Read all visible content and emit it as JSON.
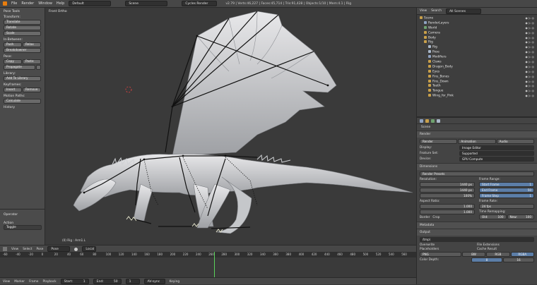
{
  "topbar": {
    "menus": [
      "File",
      "Render",
      "Window",
      "Help"
    ],
    "layout": "Default",
    "scene": "Scene",
    "engine": "Cycles Render",
    "info": "v2.79 | Verts:46,227 | Faces:45,714 | Tris:91,428 | Objects:1/10 | Mem:4.1 | Rig"
  },
  "tools": {
    "pose_tools": "Pose Tools",
    "transform": "Transform:",
    "translate": "Translate",
    "rotate": "Rotate",
    "scale": "Scale",
    "in_between": "In-Between:",
    "push": "Push",
    "relax": "Relax",
    "breakdowner": "Breakdowner",
    "pose": "Pose:",
    "copy": "Copy",
    "paste": "Paste",
    "propagate": "Propagate",
    "library": "Library:",
    "add_to_library": "Add To Library",
    "keyframes": "Keyframes:",
    "insert": "Insert",
    "remove": "Remove",
    "motion_paths": "Motion Paths:",
    "calculate": "Calculate",
    "history": "History",
    "op_title": "Operator",
    "action": "Action",
    "toggle": "Toggle"
  },
  "viewport": {
    "view_label": "Front Ortho",
    "object_label": "(0) Rig : Arm1.L"
  },
  "outliner": {
    "view": "View",
    "search": "Search",
    "filter": "All Scenes",
    "items": [
      {
        "label": "Scene",
        "indent": 0,
        "color": "#c9a04a"
      },
      {
        "label": "RenderLayers",
        "indent": 1,
        "color": "#8fa3c2"
      },
      {
        "label": "World",
        "indent": 1,
        "color": "#6fa26f"
      },
      {
        "label": "Camera",
        "indent": 1,
        "color": "#c9a04a"
      },
      {
        "label": "Body",
        "indent": 1,
        "color": "#c9a04a"
      },
      {
        "label": "Rig",
        "indent": 1,
        "color": "#c9a04a"
      },
      {
        "label": "Rig",
        "indent": 2,
        "color": "#a9b7c9"
      },
      {
        "label": "Pose",
        "indent": 2,
        "color": "#a9b7c9"
      },
      {
        "label": "Modifiers",
        "indent": 2,
        "color": "#8fa3c2"
      },
      {
        "label": "Claws",
        "indent": 2,
        "color": "#c9a04a"
      },
      {
        "label": "Dragon_Body",
        "indent": 2,
        "color": "#c9a04a"
      },
      {
        "label": "Eyes",
        "indent": 2,
        "color": "#c9a04a"
      },
      {
        "label": "Fins_Bones",
        "indent": 2,
        "color": "#c9a04a"
      },
      {
        "label": "Fins_Down",
        "indent": 2,
        "color": "#c9a04a"
      },
      {
        "label": "Teeth",
        "indent": 2,
        "color": "#c9a04a"
      },
      {
        "label": "Tongue",
        "indent": 2,
        "color": "#c9a04a"
      },
      {
        "label": "Wing_for_Pink",
        "indent": 2,
        "color": "#c9a04a"
      }
    ]
  },
  "properties": {
    "scene": "Scene",
    "render_panel": "Render",
    "render_btn": "Render",
    "animation_btn": "Animation",
    "audio_btn": "Audio",
    "display_label": "Display:",
    "display_value": "Image Editor",
    "feature_label": "Feature Set:",
    "feature_value": "Supported",
    "device_label": "Device:",
    "device_value": "GPU Compute",
    "dimensions_panel": "Dimensions",
    "render_presets": "Render Presets",
    "resolution": "Resolution:",
    "res_x": "1440 px",
    "res_y": "1440 px",
    "res_pct": "100%",
    "frame_range": "Frame Range:",
    "start_frame": "Start Frame",
    "start_val": "1",
    "end_frame": "End Frame",
    "end_val": "50",
    "frame_step": "Frame Step",
    "step_val": "1",
    "aspect_ratio": "Aspect Ratio:",
    "asp_x": "1.000",
    "asp_y": "1.000",
    "frame_rate": "Frame Rate:",
    "fps": "24 fps",
    "time_remapping": "Time Remapping:",
    "old": "Old:",
    "old_val": "100",
    "new": "New:",
    "new_val": "100",
    "border": "Border",
    "crop": "Crop",
    "metadata_panel": "Metadata",
    "output_panel": "Output",
    "output_path": "/tmp\\",
    "overwrite": "Overwrite",
    "file_ext": "File Extensions",
    "placeholders": "Placeholders",
    "cache_result": "Cache Result",
    "format": "PNG",
    "bw": "BW",
    "rgb": "RGB",
    "rgba": "RGBA",
    "color_depth": "Color Depth:",
    "depth8": "8",
    "depth16": "16"
  },
  "tlheader": {
    "view": "View",
    "select": "Select",
    "pose": "Pose",
    "mode": "Pose Mode",
    "pivot": "Local"
  },
  "timeline": {
    "ticks": [
      "-60",
      "-40",
      "-20",
      "0",
      "20",
      "40",
      "60",
      "80",
      "100",
      "120",
      "140",
      "160",
      "180",
      "200",
      "220",
      "240",
      "260",
      "280",
      "300",
      "320",
      "340",
      "360",
      "380",
      "400",
      "420",
      "440",
      "460",
      "480",
      "500",
      "520",
      "540",
      "560"
    ],
    "current_frame": 1
  },
  "bottombar": {
    "view": "View",
    "marker": "Marker",
    "frame": "Frame",
    "playback": "Playback",
    "start": "Start:",
    "start_val": "1",
    "end": "End:",
    "end_val": "50",
    "current": "1",
    "sync": "AV-sync",
    "keying": "Keying"
  }
}
